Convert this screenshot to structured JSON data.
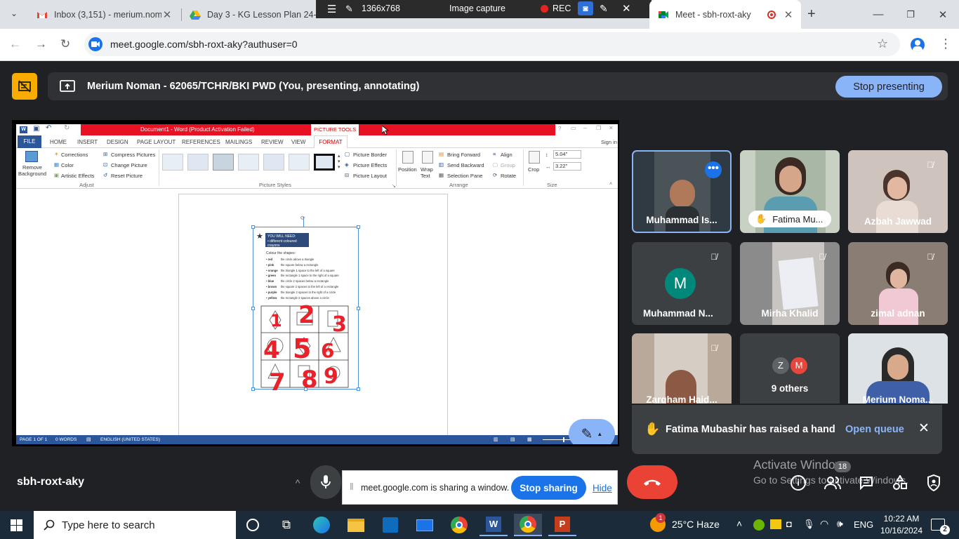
{
  "browser": {
    "tabs": [
      {
        "title": "Inbox (3,151) - merium.nom"
      },
      {
        "title": "Day 3 - KG Lesson Plan 24-2"
      },
      {
        "title": "Meet - sbh-roxt-aky"
      }
    ],
    "url": "meet.google.com/sbh-roxt-aky?authuser=0"
  },
  "capture_bar": {
    "resolution": "1366x768",
    "label": "Image capture",
    "rec": "REC"
  },
  "presenting": {
    "text": "Merium Noman - 62065/TCHR/BKI PWD (You, presenting, annotating)",
    "stop_label": "Stop presenting"
  },
  "word": {
    "title": "Document1 - Word (Product Activation Failed)",
    "picture_tools": "PICTURE TOOLS",
    "sign_in": "Sign in",
    "tabs": [
      "FILE",
      "HOME",
      "INSERT",
      "DESIGN",
      "PAGE LAYOUT",
      "REFERENCES",
      "MAILINGS",
      "REVIEW",
      "VIEW",
      "FORMAT"
    ],
    "adjust": {
      "remove_background": "Remove Background",
      "corrections": "Corrections",
      "color": "Color",
      "artistic": "Artistic Effects",
      "compress": "Compress Pictures",
      "change": "Change Picture",
      "reset": "Reset Picture",
      "group": "Adjust"
    },
    "styles_group": "Picture Styles",
    "arrange": {
      "border": "Picture Border",
      "effects": "Picture Effects",
      "layout": "Picture Layout",
      "position": "Position",
      "wrap": "Wrap Text",
      "forward": "Bring Forward",
      "backward": "Send Backward",
      "pane": "Selection Pane",
      "align": "Align",
      "group_btn": "Group",
      "rotate": "Rotate",
      "group": "Arrange"
    },
    "size": {
      "crop": "Crop",
      "height": "5.04\"",
      "width": "3.22\"",
      "group": "Size"
    },
    "status": {
      "page": "PAGE 1 OF 1",
      "words": "0 WORDS",
      "lang": "ENGLISH (UNITED STATES)"
    },
    "worksheet": {
      "badge_line1": "YOU WILL NEED:",
      "badge_line2": "• different coloured crayons",
      "heading": "Colour the shapes:",
      "rows": [
        {
          "color": "red",
          "desc": "the circle above a triangle"
        },
        {
          "color": "pink",
          "desc": "the square below a rectangle"
        },
        {
          "color": "orange",
          "desc": "the triangle 1 space to the left of a square"
        },
        {
          "color": "green",
          "desc": "the rectangle 1 space to the right of a square"
        },
        {
          "color": "blue",
          "desc": "the circle 2 spaces below a rectangle"
        },
        {
          "color": "brown",
          "desc": "the square 2 spaces to the left of a rectangle"
        },
        {
          "color": "purple",
          "desc": "the triangle 2 spaces to the right of a circle"
        },
        {
          "color": "yellow",
          "desc": "the rectangle 2 spaces above a circle"
        }
      ],
      "numbers": [
        "1",
        "2",
        "3",
        "4",
        "5",
        "6",
        "7",
        "8",
        "9"
      ]
    }
  },
  "participants": [
    {
      "name": "Muhammad Is..."
    },
    {
      "name": "Fatima Mu..."
    },
    {
      "name": "Azbah Jawwad"
    },
    {
      "name": "Muhammad N...",
      "initial": "M"
    },
    {
      "name": "Mirha Khalid"
    },
    {
      "name": "zimal adnan"
    },
    {
      "name": "Zargham Haid..."
    },
    {
      "name": "9 others",
      "initials": [
        "Z",
        "M"
      ]
    },
    {
      "name": "Merium Noma..."
    }
  ],
  "hand_raise": {
    "text": "Fatima Mubashir has raised a hand",
    "action": "Open queue"
  },
  "meeting_code": "sbh-roxt-aky",
  "sharing": {
    "text": "meet.google.com is sharing a window.",
    "stop": "Stop sharing",
    "hide": "Hide"
  },
  "watermark": {
    "line1": "Activate Windows",
    "line2": "Go to Settings to activate Windows."
  },
  "people_count": "18",
  "taskbar": {
    "search_placeholder": "Type here to search",
    "weather": "25°C  Haze",
    "weather_badge": "1",
    "lang": "ENG",
    "time": "10:22 AM",
    "date": "10/16/2024",
    "notifications": "2"
  },
  "colors": {
    "accent_blue": "#8ab4f8",
    "end_call": "#ea4335",
    "word_red": "#e81123",
    "word_blue": "#2b579a"
  }
}
